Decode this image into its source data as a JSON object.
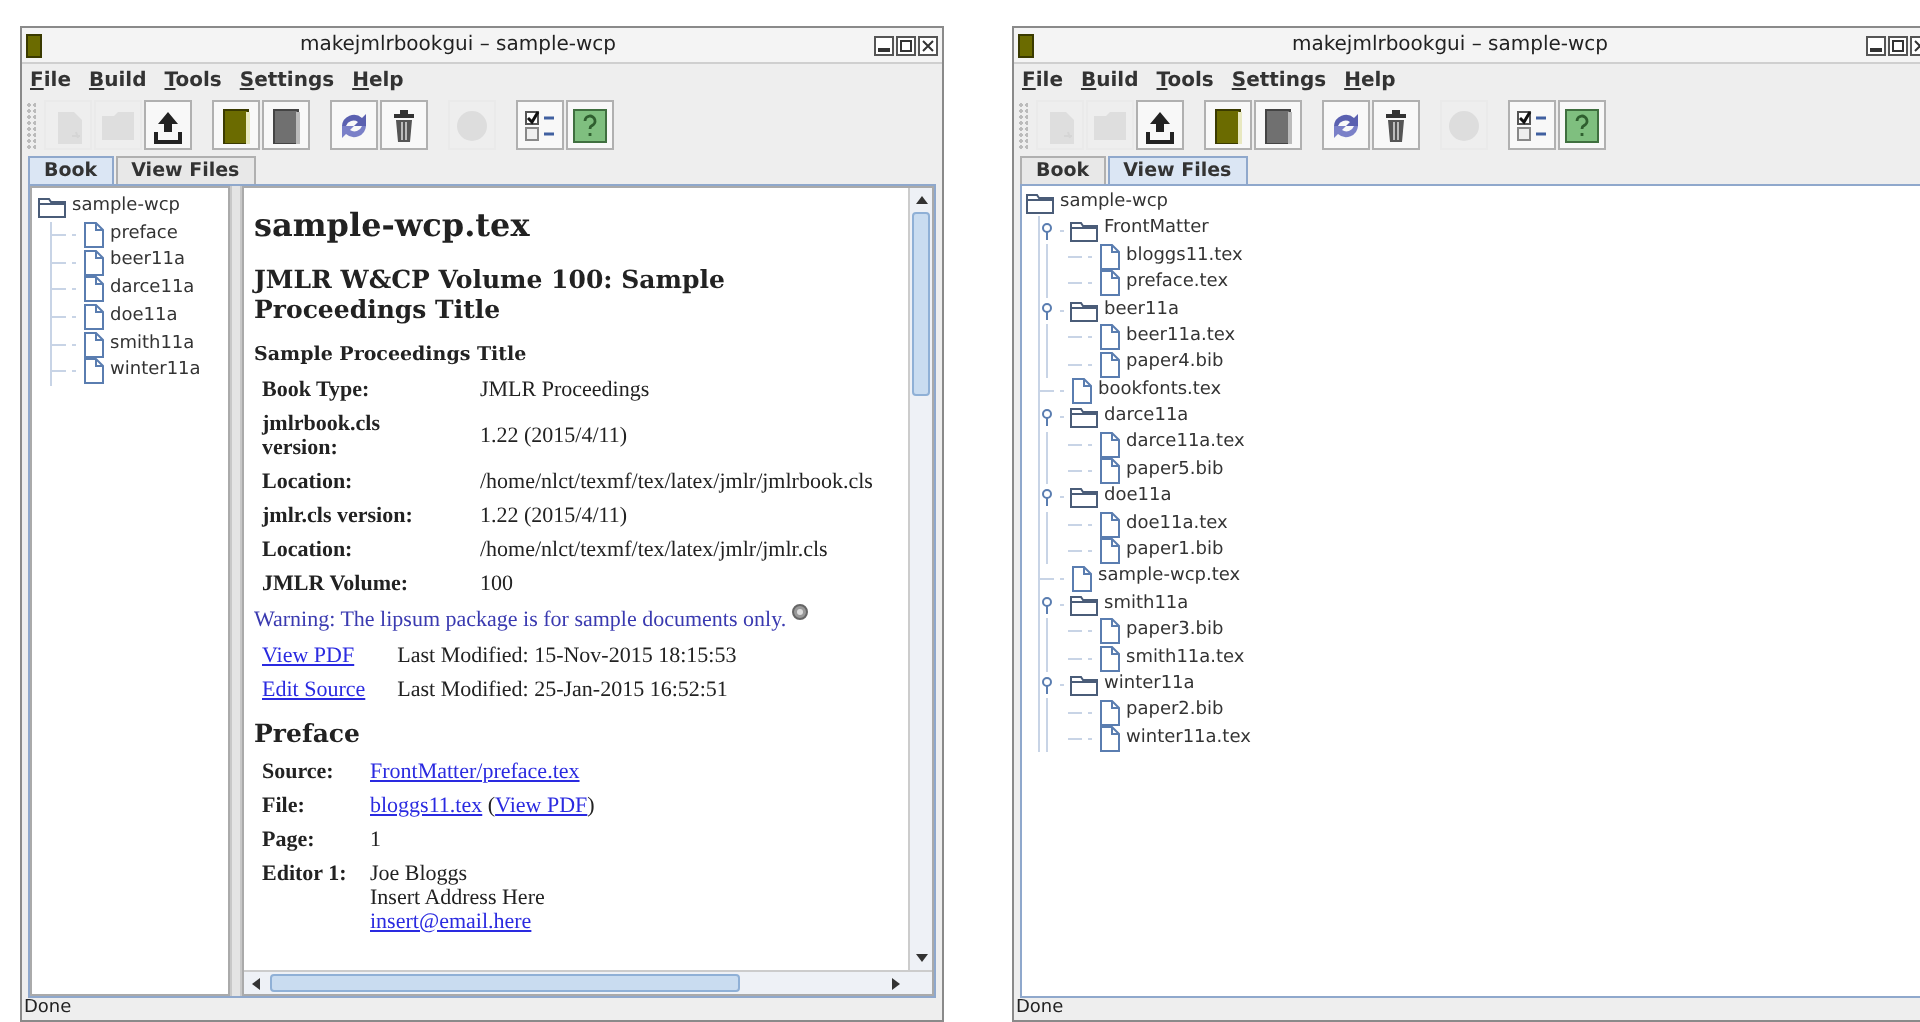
{
  "windows": [
    {
      "title": "makejmlrbookgui – sample-wcp",
      "menu": [
        "File",
        "Build",
        "Tools",
        "Settings",
        "Help"
      ],
      "toolbar": [
        [
          {
            "kind": "new-file",
            "disabled": true
          },
          {
            "kind": "open-folder",
            "disabled": true
          },
          {
            "kind": "upload",
            "disabled": false
          }
        ],
        [
          {
            "kind": "book-olive",
            "disabled": false
          },
          {
            "kind": "book-grey",
            "disabled": false
          }
        ],
        [
          {
            "kind": "refresh",
            "disabled": false
          },
          {
            "kind": "trash",
            "disabled": false
          }
        ],
        [
          {
            "kind": "stop",
            "disabled": true
          }
        ],
        [
          {
            "kind": "checklist",
            "disabled": false
          },
          {
            "kind": "help",
            "disabled": false
          }
        ]
      ],
      "tabs": [
        {
          "label": "Book",
          "selected": true
        },
        {
          "label": "View Files",
          "selected": false
        }
      ],
      "tree": {
        "label": "sample-wcp",
        "kind": "folder",
        "children": [
          {
            "label": "preface",
            "kind": "file"
          },
          {
            "label": "beer11a",
            "kind": "file"
          },
          {
            "label": "darce11a",
            "kind": "file"
          },
          {
            "label": "doe11a",
            "kind": "file"
          },
          {
            "label": "smith11a",
            "kind": "file"
          },
          {
            "label": "winter11a",
            "kind": "file"
          }
        ]
      },
      "document": {
        "title": "sample-wcp.tex",
        "heading": "JMLR W&CP Volume 100: Sample Proceedings Title",
        "subheading": "Sample Proceedings Title",
        "info_rows": [
          {
            "label": "Book Type:",
            "value": "JMLR Proceedings"
          },
          {
            "label": "jmlrbook.cls version:",
            "value": "1.22 (2015/4/11)"
          },
          {
            "label": "Location:",
            "value": "/home/nlct/texmf/tex/latex/jmlr/jmlrbook.cls"
          },
          {
            "label": "jmlr.cls version:",
            "value": "1.22 (2015/4/11)"
          },
          {
            "label": "Location:",
            "value": "/home/nlct/texmf/tex/latex/jmlr/jmlr.cls"
          },
          {
            "label": "JMLR Volume:",
            "value": "100"
          }
        ],
        "warning": "Warning: The lipsum package is for sample documents only.",
        "actions": [
          {
            "link": "View PDF",
            "text": "Last Modified: 15-Nov-2015 18:15:53"
          },
          {
            "link": "Edit Source",
            "text": "Last Modified: 25-Jan-2015 16:52:51"
          }
        ],
        "section": "Preface",
        "section_rows": [
          {
            "label": "Source:",
            "lines": [
              [
                {
                  "text": "FrontMatter/preface.tex",
                  "link": true
                }
              ]
            ]
          },
          {
            "label": "File:",
            "lines": [
              [
                {
                  "text": "bloggs11.tex",
                  "link": true
                },
                {
                  "text": " (",
                  "link": false
                },
                {
                  "text": "View PDF",
                  "link": true
                },
                {
                  "text": ")",
                  "link": false
                }
              ]
            ]
          },
          {
            "label": "Page:",
            "lines": [
              [
                {
                  "text": "1",
                  "link": false
                }
              ]
            ]
          },
          {
            "label": "Editor 1:",
            "lines": [
              [
                {
                  "text": "Joe Bloggs",
                  "link": false
                }
              ],
              [
                {
                  "text": "Insert Address Here",
                  "link": false
                }
              ],
              [
                {
                  "text": "insert@email.here",
                  "link": true
                }
              ]
            ]
          }
        ]
      },
      "status_bar": "Done"
    },
    {
      "title": "makejmlrbookgui – sample-wcp",
      "menu": [
        "File",
        "Build",
        "Tools",
        "Settings",
        "Help"
      ],
      "toolbar": [
        [
          {
            "kind": "new-file",
            "disabled": true
          },
          {
            "kind": "open-folder",
            "disabled": true
          },
          {
            "kind": "upload",
            "disabled": false
          }
        ],
        [
          {
            "kind": "book-olive",
            "disabled": false
          },
          {
            "kind": "book-grey",
            "disabled": false
          }
        ],
        [
          {
            "kind": "refresh",
            "disabled": false
          },
          {
            "kind": "trash",
            "disabled": false
          }
        ],
        [
          {
            "kind": "stop",
            "disabled": true
          }
        ],
        [
          {
            "kind": "checklist",
            "disabled": false
          },
          {
            "kind": "help",
            "disabled": false
          }
        ]
      ],
      "tabs": [
        {
          "label": "Book",
          "selected": false
        },
        {
          "label": "View Files",
          "selected": true
        }
      ],
      "tree": {
        "label": "sample-wcp",
        "kind": "folder",
        "children": [
          {
            "label": "FrontMatter",
            "kind": "folder",
            "expanded": true,
            "children": [
              {
                "label": "bloggs11.tex",
                "kind": "file"
              },
              {
                "label": "preface.tex",
                "kind": "file"
              }
            ]
          },
          {
            "label": "beer11a",
            "kind": "folder",
            "expanded": true,
            "children": [
              {
                "label": "beer11a.tex",
                "kind": "file"
              },
              {
                "label": "paper4.bib",
                "kind": "file"
              }
            ]
          },
          {
            "label": "bookfonts.tex",
            "kind": "file"
          },
          {
            "label": "darce11a",
            "kind": "folder",
            "expanded": true,
            "children": [
              {
                "label": "darce11a.tex",
                "kind": "file"
              },
              {
                "label": "paper5.bib",
                "kind": "file"
              }
            ]
          },
          {
            "label": "doe11a",
            "kind": "folder",
            "expanded": true,
            "children": [
              {
                "label": "doe11a.tex",
                "kind": "file"
              },
              {
                "label": "paper1.bib",
                "kind": "file"
              }
            ]
          },
          {
            "label": "sample-wcp.tex",
            "kind": "file"
          },
          {
            "label": "smith11a",
            "kind": "folder",
            "expanded": true,
            "children": [
              {
                "label": "paper3.bib",
                "kind": "file"
              },
              {
                "label": "smith11a.tex",
                "kind": "file"
              }
            ]
          },
          {
            "label": "winter11a",
            "kind": "folder",
            "expanded": true,
            "children": [
              {
                "label": "paper2.bib",
                "kind": "file"
              },
              {
                "label": "winter11a.tex",
                "kind": "file"
              }
            ]
          }
        ]
      },
      "status_bar": "Done"
    }
  ]
}
